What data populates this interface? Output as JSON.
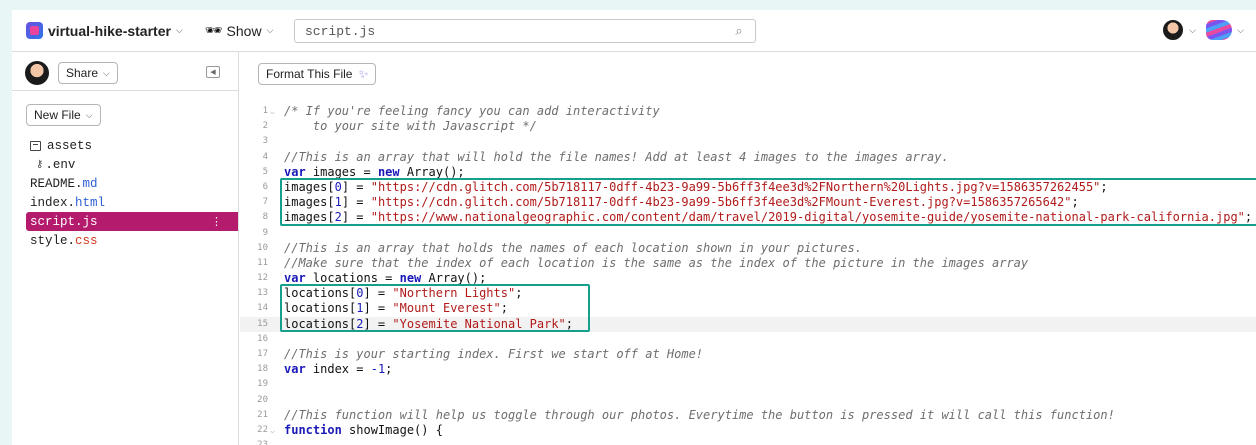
{
  "topbar": {
    "project_name": "virtual-hike-starter",
    "show_label": "Show",
    "search_value": "script.js"
  },
  "sidebar": {
    "share_label": "Share",
    "new_file_label": "New File",
    "files": [
      {
        "name": "assets",
        "ext": "",
        "type": "folder"
      },
      {
        "name": ".env",
        "ext": "",
        "type": "env"
      },
      {
        "name": "README.",
        "ext": "md",
        "type": "file"
      },
      {
        "name": "index.",
        "ext": "html",
        "type": "file"
      },
      {
        "name": "script.",
        "ext": "js",
        "type": "file",
        "active": true
      },
      {
        "name": "style.",
        "ext": "css",
        "type": "file"
      }
    ]
  },
  "editor": {
    "format_label": "Format This File",
    "lines": [
      {
        "n": "1",
        "fold": "v"
      },
      {
        "n": "2"
      },
      {
        "n": "3"
      },
      {
        "n": "4"
      },
      {
        "n": "5"
      },
      {
        "n": "6"
      },
      {
        "n": "7"
      },
      {
        "n": "8"
      },
      {
        "n": "9"
      },
      {
        "n": "10"
      },
      {
        "n": "11"
      },
      {
        "n": "12"
      },
      {
        "n": "13"
      },
      {
        "n": "14"
      },
      {
        "n": "15"
      },
      {
        "n": "16"
      },
      {
        "n": "17"
      },
      {
        "n": "18"
      },
      {
        "n": "19"
      },
      {
        "n": "20"
      },
      {
        "n": "21"
      },
      {
        "n": "22",
        "fold": "v"
      },
      {
        "n": "23"
      }
    ],
    "code": {
      "l1": "/* If you're feeling fancy you can add interactivity",
      "l2": "    to your site with Javascript */",
      "l4": "//This is an array that will hold the file names! Add at least 4 images to the images array.",
      "l5_kw1": "var",
      "l5_a": " images = ",
      "l5_kw2": "new",
      "l5_b": " Array();",
      "l6_a": "images[",
      "l6_i": "0",
      "l6_b": "] = ",
      "l6_s": "\"https://cdn.glitch.com/5b718117-0dff-4b23-9a99-5b6ff3f4ee3d%2FNorthern%20Lights.jpg?v=1586357262455\"",
      "l7_a": "images[",
      "l7_i": "1",
      "l7_b": "] = ",
      "l7_s": "\"https://cdn.glitch.com/5b718117-0dff-4b23-9a99-5b6ff3f4ee3d%2FMount-Everest.jpg?v=1586357265642\"",
      "l8_a": "images[",
      "l8_i": "2",
      "l8_b": "] = ",
      "l8_s": "\"https://www.nationalgeographic.com/content/dam/travel/2019-digital/yosemite-guide/yosemite-national-park-california.jpg\"",
      "l10": "//This is an array that holds the names of each location shown in your pictures.",
      "l11": "//Make sure that the index of each location is the same as the index of the picture in the images array",
      "l12_kw1": "var",
      "l12_a": " locations = ",
      "l12_kw2": "new",
      "l12_b": " Array();",
      "l13_a": "locations[",
      "l13_i": "0",
      "l13_b": "] = ",
      "l13_s": "\"Northern Lights\"",
      "l14_a": "locations[",
      "l14_i": "1",
      "l14_b": "] = ",
      "l14_s": "\"Mount Everest\"",
      "l15_a": "locations[",
      "l15_i": "2",
      "l15_b": "] = ",
      "l15_s": "\"Yosemite National Park\"",
      "l17": "//This is your starting index. First we start off at Home!",
      "l18_kw": "var",
      "l18_a": " index = ",
      "l18_n": "-1",
      "l18_b": ";",
      "l21": "//This function will help us toggle through our photos. Everytime the button is pressed it will call this function!",
      "l22_kw": "function",
      "l22_a": " showImage() {"
    }
  }
}
